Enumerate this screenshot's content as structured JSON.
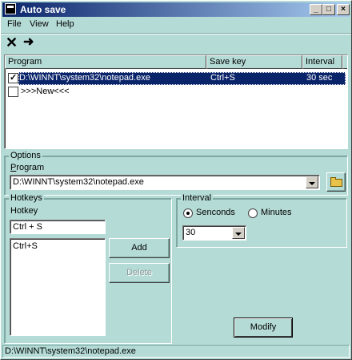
{
  "window": {
    "title": "Auto save"
  },
  "menu": [
    "File",
    "View",
    "Help"
  ],
  "toolbar": {
    "delete_icon": "close-x-icon",
    "run_icon": "arrow-right-icon"
  },
  "list": {
    "columns": [
      "Program",
      "Save key",
      "Interval"
    ],
    "rows": [
      {
        "program": "D:\\WINNT\\system32\\notepad.exe",
        "key": "Ctrl+S",
        "interval": "30 sec",
        "checked": true,
        "selected": true
      },
      {
        "program": ">>>New<<<",
        "key": "",
        "interval": "",
        "checked": false,
        "selected": false
      }
    ]
  },
  "options": {
    "group_label": "Options",
    "program_label": "Program",
    "program_value": "D:\\WINNT\\system32\\notepad.exe"
  },
  "hotkeys": {
    "group_label": "Hotkeys",
    "hotkey_label": "Hotkey",
    "hotkey_value": "Ctrl + S",
    "list_items": [
      "Ctrl+S"
    ],
    "add_label": "Add",
    "delete_label": "Delete"
  },
  "interval": {
    "group_label": "Interval",
    "radio_seconds": "Senconds",
    "radio_minutes": "Minutes",
    "selected": "seconds",
    "value": "30"
  },
  "modify_label": "Modify",
  "status_text": "D:\\WINNT\\system32\\notepad.exe",
  "colors": {
    "face": "#b5dbd6",
    "title_start": "#0a246a",
    "title_end": "#a6caf0",
    "selection": "#0a246a"
  }
}
